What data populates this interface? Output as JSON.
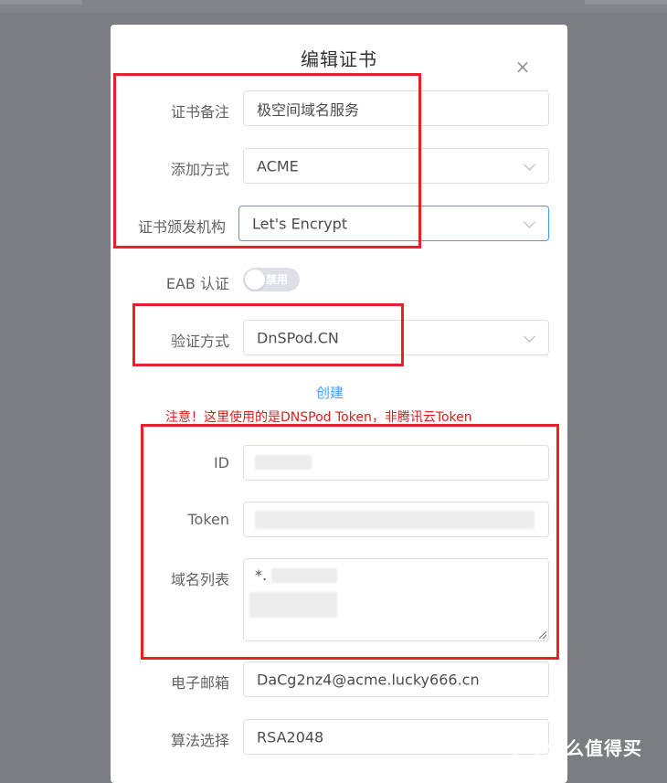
{
  "dialog": {
    "title": "编辑证书",
    "close_glyph": "×"
  },
  "form": {
    "remark": {
      "label": "证书备注",
      "value": "极空间域名服务"
    },
    "add_method": {
      "label": "添加方式",
      "value": "ACME"
    },
    "issuer": {
      "label": "证书颁发机构",
      "value": "Let's Encrypt"
    },
    "eab": {
      "label": "EAB 认证",
      "switch_text": "禁用",
      "enabled": false
    },
    "verify_method": {
      "label": "验证方式",
      "value": "DnSPod.CN"
    },
    "create_link": "创建",
    "warning": "注意！这里使用的是DNSPod Token，非腾讯云Token",
    "id": {
      "label": "ID"
    },
    "token": {
      "label": "Token"
    },
    "domains": {
      "label": "域名列表",
      "prefix": "*."
    },
    "email": {
      "label": "电子邮箱",
      "value": "DaCg2nz4@acme.lucky666.cn"
    },
    "algorithm": {
      "label": "算法选择",
      "value": "RSA2048"
    }
  },
  "watermark": {
    "logo_glyph": "值",
    "text": "什么值得买"
  },
  "colors": {
    "highlight_box": "#e8202a",
    "link": "#409eff",
    "warning": "#e01b1b"
  }
}
